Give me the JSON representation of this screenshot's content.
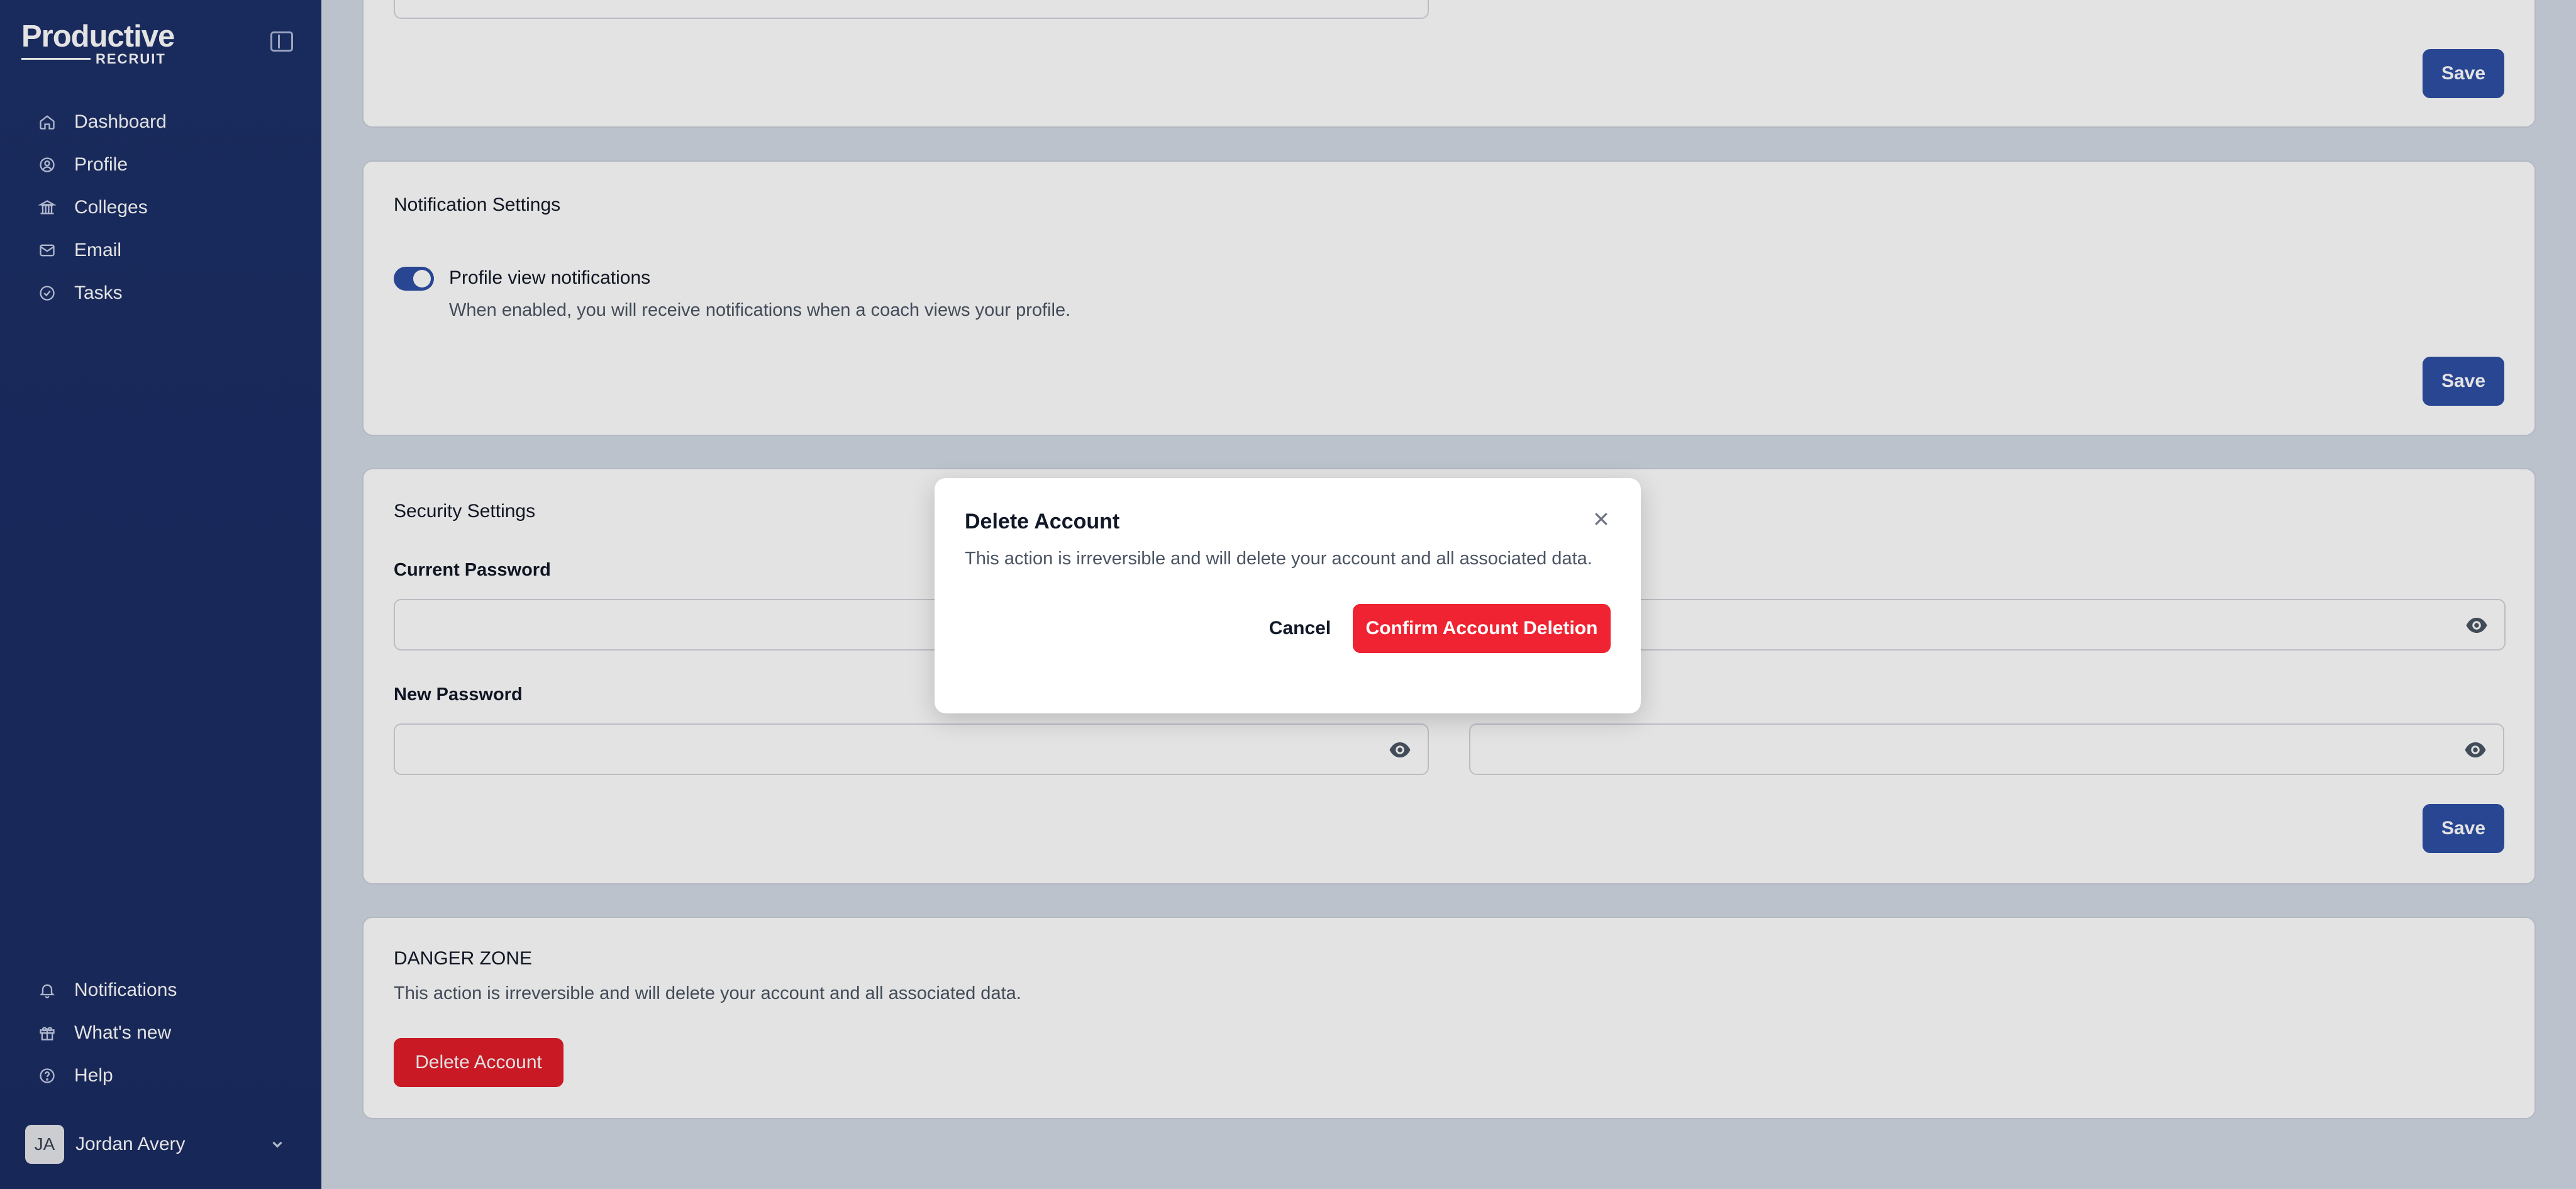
{
  "app": {
    "logo_word": "Productive",
    "logo_sub": "RECRUIT"
  },
  "sidebar": {
    "items": [
      {
        "label": "Dashboard",
        "icon": "home-icon"
      },
      {
        "label": "Profile",
        "icon": "user-circle-icon"
      },
      {
        "label": "Colleges",
        "icon": "building-icon"
      },
      {
        "label": "Email",
        "icon": "mail-icon"
      },
      {
        "label": "Tasks",
        "icon": "check-circle-icon"
      }
    ],
    "bottom_items": [
      {
        "label": "Notifications",
        "icon": "bell-icon"
      },
      {
        "label": "What's new",
        "icon": "gift-icon"
      },
      {
        "label": "Help",
        "icon": "help-circle-icon"
      }
    ],
    "user": {
      "initials": "JA",
      "name": "Jordan Avery"
    }
  },
  "main": {
    "top_card": {
      "save_label": "Save"
    },
    "notification_settings": {
      "title": "Notification Settings",
      "toggle_label": "Profile view notifications",
      "toggle_on": true,
      "toggle_desc": "When enabled, you will receive notifications when a coach views your profile.",
      "save_label": "Save"
    },
    "security_settings": {
      "title": "Security Settings",
      "current_password_label": "Current Password",
      "new_password_label": "New Password",
      "save_label": "Save"
    },
    "danger_zone": {
      "title": "DANGER ZONE",
      "desc": "This action is irreversible and will delete your account and all associated data.",
      "button_label": "Delete Account"
    }
  },
  "modal": {
    "title": "Delete Account",
    "desc": "This action is irreversible and will delete your account and all associated data.",
    "cancel_label": "Cancel",
    "confirm_label": "Confirm Account Deletion"
  },
  "colors": {
    "sidebar_bg": "#1d3068",
    "primary": "#2f4fa6",
    "danger": "#e11d2a"
  }
}
